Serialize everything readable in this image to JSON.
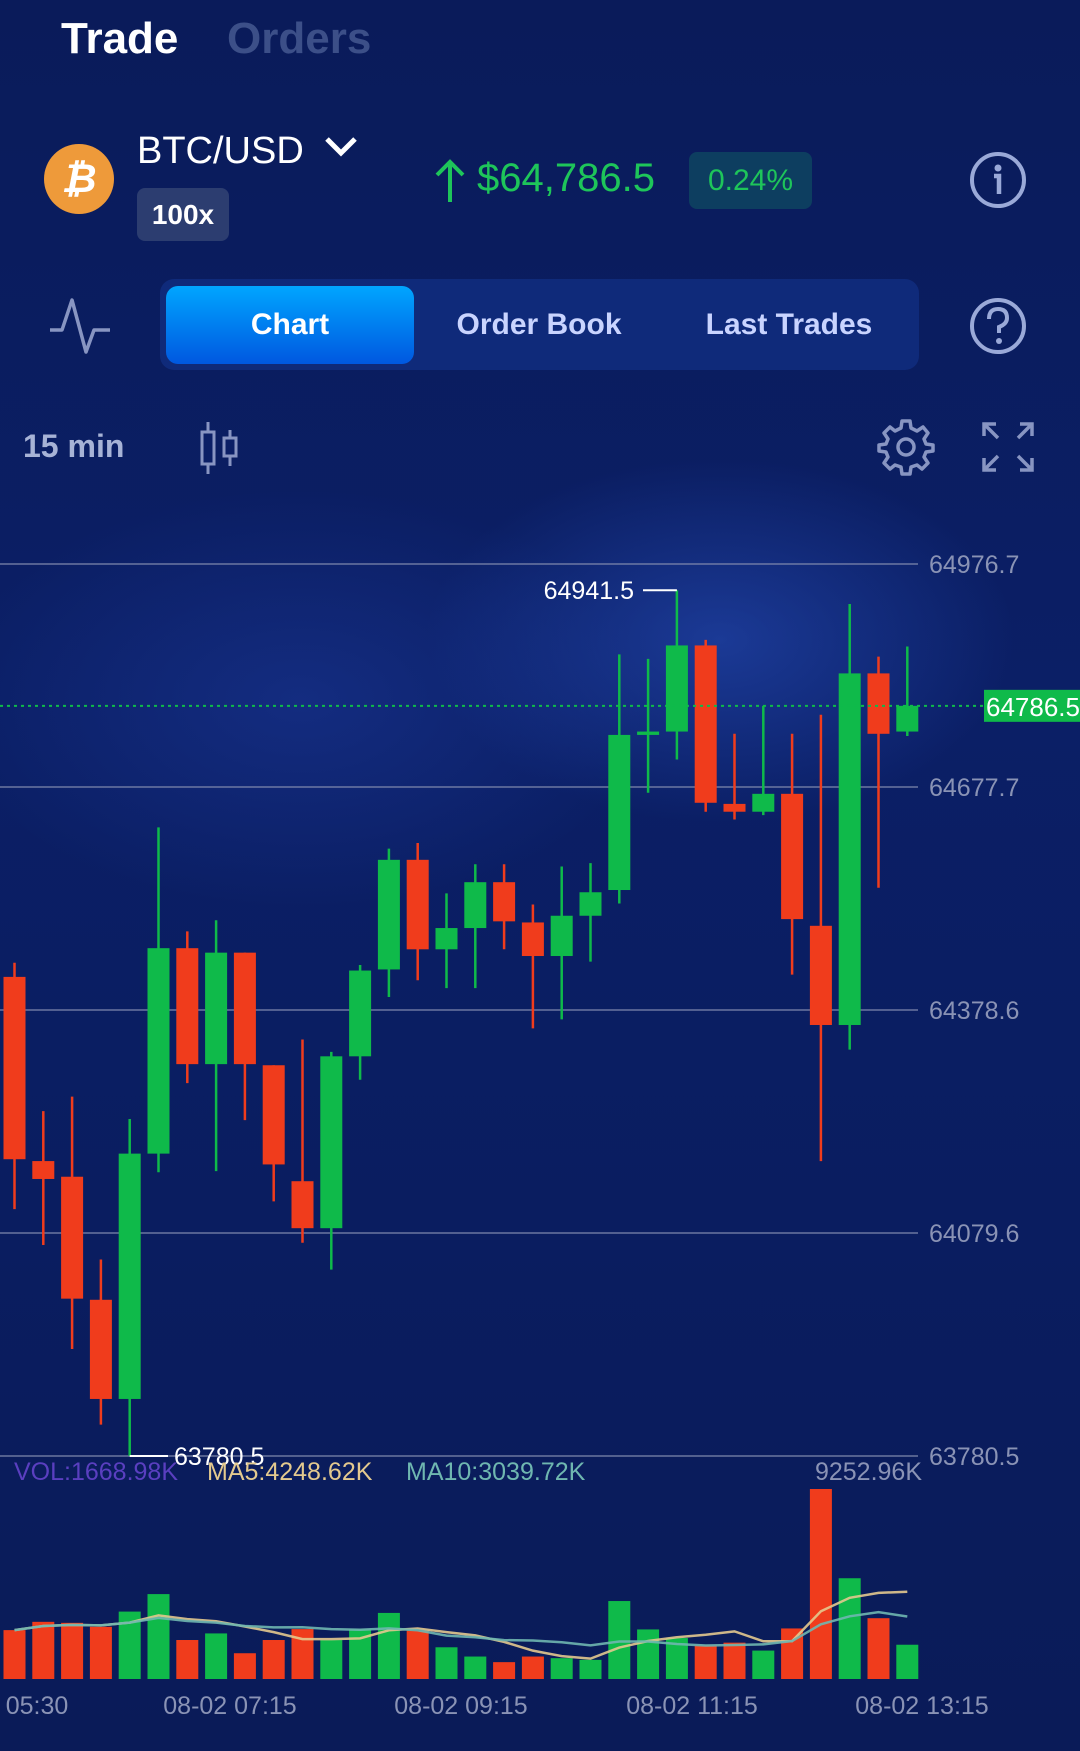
{
  "header": {
    "tabs": [
      {
        "label": "Trade",
        "active": true
      },
      {
        "label": "Orders",
        "active": false
      }
    ]
  },
  "ticker": {
    "pair": "BTC/USD",
    "leverage": "100x",
    "price": "$64,786.5",
    "change": "0.24%",
    "icons": {
      "coin": "bitcoin-icon",
      "dropdown": "chevron-down-icon",
      "trend": "arrow-up-icon",
      "info": "info-icon"
    }
  },
  "view_tabs": {
    "items": [
      {
        "label": "Chart",
        "active": true
      },
      {
        "label": "Order Book",
        "active": false
      },
      {
        "label": "Last Trades",
        "active": false
      }
    ]
  },
  "toolbar": {
    "interval": "15 min"
  },
  "colors": {
    "up": "#0fba4a",
    "down": "#f03c1c",
    "accent": "#0a7cff",
    "background": "#0a1d60",
    "ma5": "#e3c98e",
    "ma10": "#6fb7b0",
    "vol": "#5a3fc0"
  },
  "chart_data": {
    "type": "candlestick",
    "y_axis": {
      "ticks": [
        "64976.7",
        "64677.7",
        "64378.6",
        "64079.6",
        "63780.5"
      ],
      "range": [
        63780.5,
        64976.7
      ]
    },
    "current_price": "64786.5",
    "high_label": "64941.5",
    "low_label": "63780.5",
    "x_labels": [
      "05:30",
      "08-02 07:15",
      "08-02 09:15",
      "08-02 11:15",
      "08-02 13:15"
    ],
    "candles": [
      {
        "o": 64423,
        "h": 64442,
        "l": 64111.5,
        "c": 64178.5
      },
      {
        "o": 64176,
        "h": 64243,
        "l": 64063.5,
        "c": 64152
      },
      {
        "o": 64155,
        "h": 64262.5,
        "l": 63924,
        "c": 63991.5
      },
      {
        "o": 63990,
        "h": 64044,
        "l": 63822.5,
        "c": 63857
      },
      {
        "o": 63857,
        "h": 64232.5,
        "l": 63780.5,
        "c": 64186
      },
      {
        "o": 64186,
        "h": 64623.5,
        "l": 64161,
        "c": 64461.5
      },
      {
        "o": 64461.5,
        "h": 64484,
        "l": 64280.5,
        "c": 64306
      },
      {
        "o": 64306,
        "h": 64499,
        "l": 64162.5,
        "c": 64455.5
      },
      {
        "o": 64455.5,
        "h": 64455.5,
        "l": 64231,
        "c": 64306
      },
      {
        "o": 64304.5,
        "h": 64304.5,
        "l": 64122,
        "c": 64171.5
      },
      {
        "o": 64149,
        "h": 64339,
        "l": 64066.5,
        "c": 64086
      },
      {
        "o": 64086,
        "h": 64322.5,
        "l": 64030.5,
        "c": 64316.5
      },
      {
        "o": 64316.5,
        "h": 64439,
        "l": 64285,
        "c": 64431.5
      },
      {
        "o": 64433,
        "h": 64595,
        "l": 64396,
        "c": 64580
      },
      {
        "o": 64580,
        "h": 64602.5,
        "l": 64418.5,
        "c": 64460
      },
      {
        "o": 64460,
        "h": 64535,
        "l": 64408,
        "c": 64488.5
      },
      {
        "o": 64488.5,
        "h": 64574,
        "l": 64408,
        "c": 64550
      },
      {
        "o": 64550,
        "h": 64574,
        "l": 64460,
        "c": 64497.5
      },
      {
        "o": 64496,
        "h": 64520,
        "l": 64354,
        "c": 64451
      },
      {
        "o": 64451,
        "h": 64571,
        "l": 64366,
        "c": 64505
      },
      {
        "o": 64505,
        "h": 64575.5,
        "l": 64443.5,
        "c": 64536.5
      },
      {
        "o": 64539.5,
        "h": 64855.5,
        "l": 64521.5,
        "c": 64747.5
      },
      {
        "o": 64747.5,
        "h": 64849.5,
        "l": 64670,
        "c": 64752
      },
      {
        "o": 64752,
        "h": 64941.5,
        "l": 64714.5,
        "c": 64867.5
      },
      {
        "o": 64867.5,
        "h": 64875,
        "l": 64644.5,
        "c": 64656.5
      },
      {
        "o": 64655,
        "h": 64749,
        "l": 64634,
        "c": 64644.5
      },
      {
        "o": 64644.5,
        "h": 64786.5,
        "l": 64640,
        "c": 64668.5
      },
      {
        "o": 64668.5,
        "h": 64749,
        "l": 64426,
        "c": 64500.5
      },
      {
        "o": 64491.5,
        "h": 64774.5,
        "l": 64176,
        "c": 64358.5
      },
      {
        "o": 64358.5,
        "h": 64923,
        "l": 64325.5,
        "c": 64830
      },
      {
        "o": 64830,
        "h": 64852.5,
        "l": 64542.5,
        "c": 64749
      },
      {
        "o": 64752,
        "h": 64866,
        "l": 64746,
        "c": 64786.5
      }
    ],
    "volume_K": [
      2381,
      2784,
      2735,
      2542,
      3283,
      4135,
      1899,
      2220,
      1255,
      1899,
      2430,
      1899,
      2414,
      3218,
      2349,
      1545,
      1094,
      821,
      1094,
      1014,
      933,
      3797,
      2414,
      1995,
      1625,
      1770,
      1384,
      2462,
      9253,
      4907,
      2961,
      1669
    ],
    "volume_legend": {
      "vol": "VOL:1668.98K",
      "ma5": "MA5:4248.62K",
      "ma10": "MA10:3039.72K",
      "max": "9252.96K"
    }
  }
}
